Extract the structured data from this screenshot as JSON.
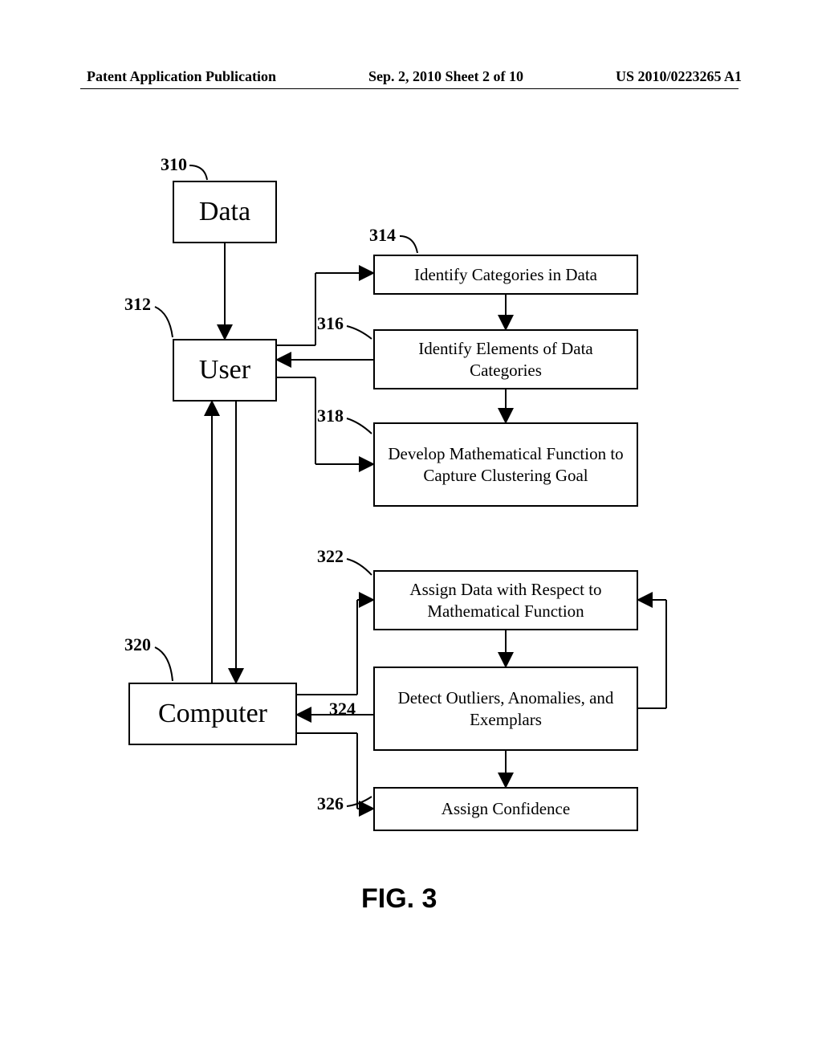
{
  "header": {
    "left": "Patent Application Publication",
    "center": "Sep. 2, 2010  Sheet 2 of 10",
    "right": "US 2010/0223265 A1"
  },
  "refs": {
    "r310": "310",
    "r312": "312",
    "r314": "314",
    "r316": "316",
    "r318": "318",
    "r320": "320",
    "r322": "322",
    "r324": "324",
    "r326": "326"
  },
  "boxes": {
    "data": "Data",
    "user": "User",
    "computer": "Computer",
    "b314": "Identify Categories in Data",
    "b316": "Identify Elements of Data Categories",
    "b318": "Develop Mathematical Function to Capture Clustering Goal",
    "b322": "Assign Data with Respect to Mathematical Function",
    "b324": "Detect Outliers, Anomalies, and Exemplars",
    "b326": "Assign Confidence"
  },
  "figcaption": "FIG. 3"
}
